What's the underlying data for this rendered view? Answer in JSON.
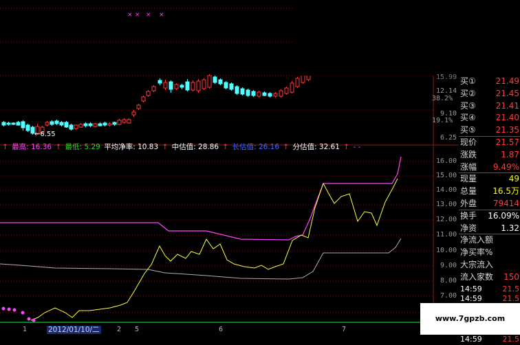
{
  "price_axis": {
    "labels": [
      "15.99",
      "12.14",
      "38.2%",
      "9.10",
      "19.1%",
      "6.25"
    ],
    "colors": [
      "#777777",
      "#9a9a9a",
      "#9a9a9a",
      "#9a9a9a",
      "#9a9a9a",
      "#9a9a9a"
    ]
  },
  "price_chart": {
    "low_mark": "6.55",
    "marker_glyph": "×"
  },
  "indicator": {
    "high_label": "最高: 16.36",
    "low_label": "最低: 5.29",
    "avg_label": "平均净率: 10.83",
    "mid_label": "中估值: 28.86",
    "long_label": "长估值: 26.16",
    "part_label": "分估值: 32.61",
    "arrow": "↑",
    "tail": "- -"
  },
  "indicator_axis": {
    "labels": [
      "16.00",
      "15.00",
      "14.00",
      "13.00",
      "12.00",
      "11.00",
      "10.00",
      "9.00",
      "8.00",
      "7.00"
    ]
  },
  "quote": {
    "rows": [
      {
        "label": "买①",
        "value": "21.49",
        "color": "#ff3b3b"
      },
      {
        "label": "买②",
        "value": "21.45",
        "color": "#ff3b3b"
      },
      {
        "label": "买③",
        "value": "21.41",
        "color": "#ff3b3b"
      },
      {
        "label": "买④",
        "value": "21.40",
        "color": "#ff3b3b"
      },
      {
        "label": "买⑤",
        "value": "21.35",
        "color": "#ff3b3b"
      },
      {
        "label": "现价",
        "value": "21.57",
        "color": "#ff3b3b"
      },
      {
        "label": "涨跌",
        "value": "1.87",
        "color": "#ff3b3b"
      },
      {
        "label": "涨幅",
        "value": "9.49%",
        "color": "#ff3b3b"
      },
      {
        "label": "现量",
        "value": "49",
        "color": "#ffff00"
      },
      {
        "label": "总量",
        "value": "16.5万",
        "color": "#ffff00"
      },
      {
        "label": "外盘",
        "value": "79414",
        "color": "#ff3b3b"
      },
      {
        "label": "换手",
        "value": "16.09%",
        "color": "#ffffff"
      },
      {
        "label": "净资",
        "value": "1.32",
        "color": "#ffffff"
      },
      {
        "label": "净流入额",
        "value": "",
        "color": "#ffffff"
      },
      {
        "label": "净买率%",
        "value": "",
        "color": "#ffffff"
      },
      {
        "label": "大宗流入",
        "value": "",
        "color": "#ffffff"
      },
      {
        "label": "流入家数",
        "value": "150",
        "color": "#ff3b3b"
      }
    ],
    "ticks": [
      {
        "time": "14:59",
        "value": "21.5"
      },
      {
        "time": "14:59",
        "value": "21.5"
      },
      {
        "time": "14:59",
        "value": "21.5"
      },
      {
        "time": "14:59",
        "value": "21.5"
      },
      {
        "time": "14:59",
        "value": "21.5"
      },
      {
        "time": "14:59",
        "value": "21.5"
      }
    ]
  },
  "date_bar": {
    "selected_date": "2012/01/10/二",
    "ticks": [
      "1",
      "2",
      "5",
      "6",
      "7"
    ]
  },
  "watermark": "www.7gpzb.com",
  "colors": {
    "up": "#ff3b3b",
    "down": "#54ffff",
    "magenta": "#ff44ff",
    "yellow": "#ffff44",
    "gray_line": "#b0b0b0",
    "green_line": "#22cc22"
  }
}
